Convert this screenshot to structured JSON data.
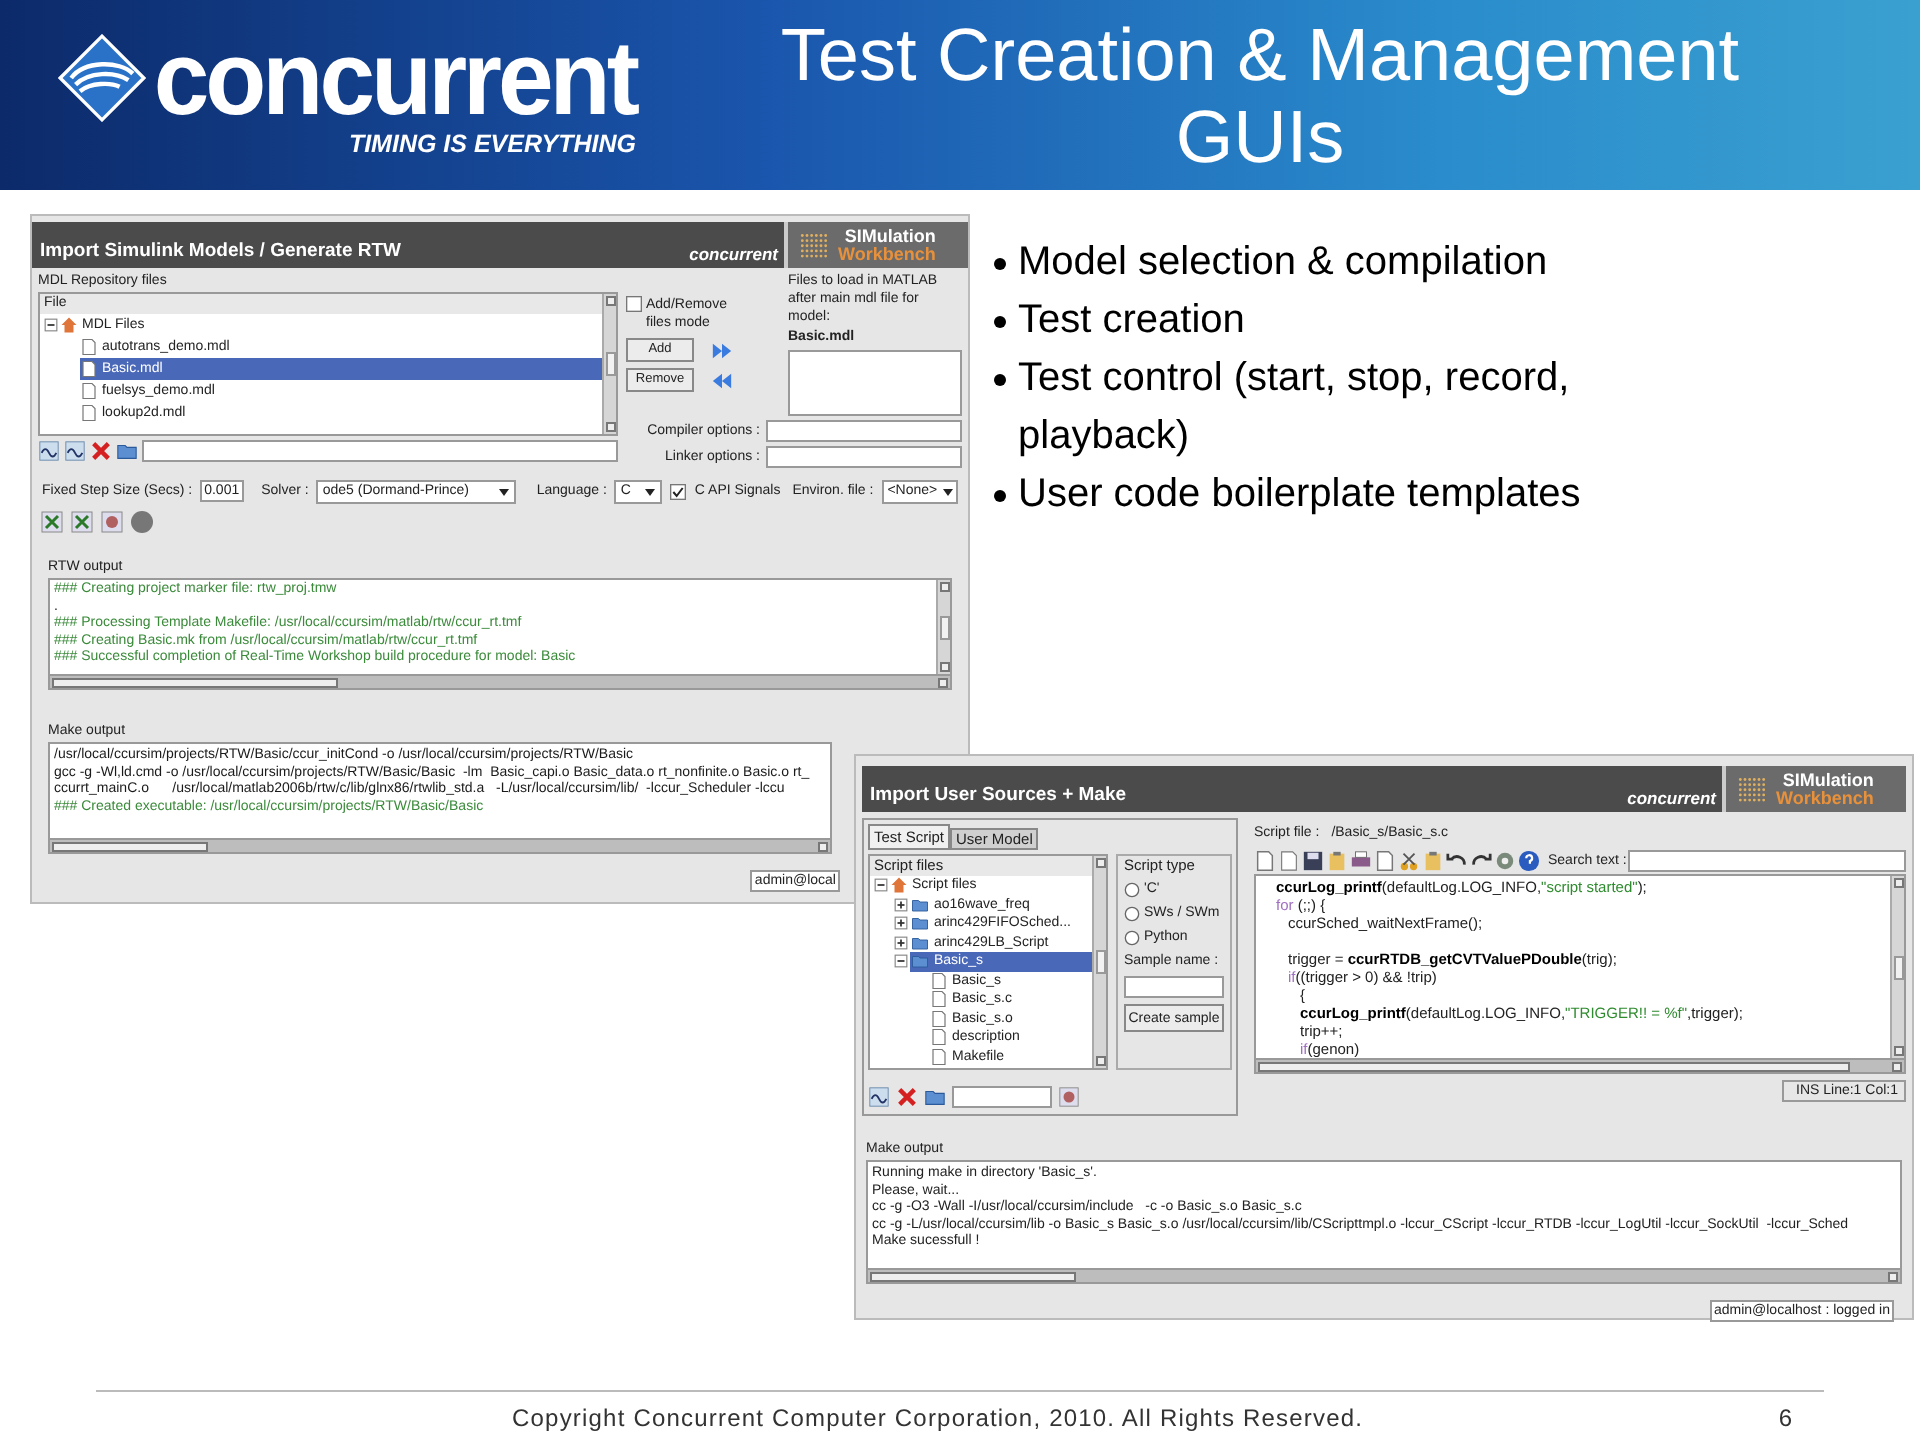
{
  "header": {
    "logo": "concurrent",
    "tagline": "TIMING IS EVERYTHING",
    "title": "Test Creation & Management GUIs"
  },
  "rtw_window": {
    "title": "Import Simulink Models / Generate RTW",
    "brand": "concurrent",
    "product_line1": "SIMulation",
    "product_line2": "Workbench",
    "repository": {
      "label": "MDL Repository files",
      "column": "File",
      "tree": [
        {
          "label": "MDL Files",
          "expanded": true,
          "selected": false,
          "children": [
            {
              "label": "autotrans_demo.mdl",
              "selected": false
            },
            {
              "label": "Basic.mdl",
              "selected": true
            },
            {
              "label": "fuelsys_demo.mdl",
              "selected": false
            },
            {
              "label": "lookup2d.mdl",
              "selected": false
            }
          ]
        }
      ]
    },
    "add_remove_mode": {
      "label": "Add/Remove files mode",
      "checked": false
    },
    "buttons": [
      "Add",
      "Remove"
    ],
    "files_to_load": {
      "label": "Files to load in MATLAB after main mdl file for model:",
      "model": "Basic.mdl"
    },
    "compiler_options": {
      "label": "Compiler options :"
    },
    "linker_options": {
      "label": "Linker options :"
    },
    "settings": {
      "step_label": "Fixed Step Size (Secs) :",
      "step_value": "0.001",
      "solver_label": "Solver :",
      "solver_value": "ode5 (Dormand-Prince)",
      "language_label": "Language :",
      "language_value": "C",
      "c_api": {
        "label": "C API Signals",
        "checked": true
      },
      "environ_label": "Environ. file :",
      "environ_value": "<None>"
    },
    "rtw_output": {
      "label": "RTW output",
      "lines": [
        {
          "text": "### Creating project marker file: rtw_proj.tmw",
          "color": "#3a8a3a"
        },
        {
          "text": "."
        },
        {
          "text": "### Processing Template Makefile: /usr/local/ccursim/matlab/rtw/ccur_rt.tmf",
          "color": "#3a8a3a"
        },
        {
          "text": "### Creating Basic.mk from /usr/local/ccursim/matlab/rtw/ccur_rt.tmf",
          "color": "#3a8a3a"
        },
        {
          "text": "### Successful completion of Real-Time Workshop build procedure for model: Basic",
          "color": "#3a8a3a"
        }
      ]
    },
    "make_output": {
      "label": "Make output",
      "lines": [
        {
          "text": "/usr/local/ccursim/projects/RTW/Basic/ccur_initCond -o /usr/local/ccursim/projects/RTW/Basic",
          "color": "#1a1a1a"
        },
        {
          "text": "gcc -g -Wl,ld.cmd -o /usr/local/ccursim/projects/RTW/Basic/Basic  -lm  Basic_capi.o Basic_data.o rt_nonfinite.o Basic.o rt_",
          "color": "#1a1a1a"
        },
        {
          "text": "ccurrt_mainC.o      /usr/local/matlab2006b/rtw/c/lib/glnx86/rtwlib_std.a   -L/usr/local/ccursim/lib/  -lccur_Scheduler -lccu",
          "color": "#1a1a1a"
        },
        {
          "text": "### Created executable: /usr/local/ccursim/projects/RTW/Basic/Basic",
          "color": "#3a8a3a"
        }
      ]
    },
    "status": "admin@local"
  },
  "bullets": [
    "Model selection & compilation",
    "Test creation",
    "Test control (start, stop, record, playback)",
    "User code boilerplate templates"
  ],
  "make_window": {
    "title": "Import User Sources + Make",
    "brand": "concurrent",
    "product_line1": "SIMulation",
    "product_line2": "Workbench",
    "tabs": [
      {
        "label": "Test Script",
        "selected": true
      },
      {
        "label": "User Model",
        "selected": false
      }
    ],
    "scripts": {
      "column": "Script files",
      "tree": [
        {
          "label": "Script files",
          "expanded": true,
          "selected": false,
          "children": [
            {
              "label": "ao16wave_freq",
              "expanded": false,
              "selected": false
            },
            {
              "label": "arinc429FIFOSched...",
              "expanded": false,
              "selected": false
            },
            {
              "label": "arinc429LB_Script",
              "expanded": false,
              "selected": false
            },
            {
              "label": "Basic_s",
              "expanded": true,
              "selected": true,
              "children": [
                {
                  "label": "Basic_s",
                  "selected": false
                },
                {
                  "label": "Basic_s.c",
                  "selected": false
                },
                {
                  "label": "Basic_s.o",
                  "selected": false
                },
                {
                  "label": "description",
                  "selected": false
                },
                {
                  "label": "Makefile",
                  "selected": false
                }
              ]
            }
          ]
        }
      ]
    },
    "script_type": {
      "label": "Script type",
      "options": [
        {
          "label": "'C'",
          "selected": false
        },
        {
          "label": "SWs / SWm",
          "selected": false
        },
        {
          "label": "Python",
          "selected": false
        }
      ]
    },
    "sample_name": {
      "label": "Sample name :"
    },
    "create_button": "Create sample",
    "script_file": {
      "label": "Script file :",
      "path": "/Basic_s/Basic_s.c"
    },
    "search": {
      "label": "Search text :"
    },
    "code": [
      {
        "kind": "code",
        "tokens": [
          {
            "text": "ccurLog_printf",
            "kind": "fn"
          },
          {
            "text": "(defaultLog.LOG_INFO,",
            "kind": "plain"
          },
          {
            "text": "\"script started\"",
            "kind": "str"
          },
          {
            "text": ");",
            "kind": "plain"
          }
        ]
      },
      {
        "kind": "code",
        "tokens": [
          {
            "text": "for",
            "kind": "kw"
          },
          {
            "text": " (;;) {",
            "kind": "plain"
          }
        ],
        "children": [
          {
            "kind": "code",
            "tokens": [
              {
                "text": "ccurSched_waitNextFrame();",
                "kind": "plain"
              }
            ]
          },
          {
            "kind": "blank"
          },
          {
            "kind": "code",
            "tokens": [
              {
                "text": "trigger = ",
                "kind": "plain"
              },
              {
                "text": "ccurRTDB_getCVTValuePDouble",
                "kind": "fn"
              },
              {
                "text": "(trig);",
                "kind": "plain"
              }
            ]
          },
          {
            "kind": "code",
            "tokens": [
              {
                "text": "if",
                "kind": "kw"
              },
              {
                "text": "((trigger > 0) && !trip)",
                "kind": "plain"
              }
            ],
            "children": [
              {
                "kind": "code",
                "tokens": [
                  {
                    "text": "{",
                    "kind": "plain"
                  }
                ]
              },
              {
                "kind": "code",
                "tokens": [
                  {
                    "text": "ccurLog_printf",
                    "kind": "fn"
                  },
                  {
                    "text": "(defaultLog.LOG_INFO,",
                    "kind": "plain"
                  },
                  {
                    "text": "\"TRIGGER!! = %f\"",
                    "kind": "str"
                  },
                  {
                    "text": ",trigger);",
                    "kind": "plain"
                  }
                ]
              },
              {
                "kind": "code",
                "tokens": [
                  {
                    "text": "trip++;",
                    "kind": "plain"
                  }
                ]
              },
              {
                "kind": "code",
                "tokens": [
                  {
                    "text": "if",
                    "kind": "kw"
                  },
                  {
                    "text": "(genon)",
                    "kind": "plain"
                  }
                ]
              }
            ]
          }
        ]
      }
    ],
    "editor_status": "INS Line:1 Col:1",
    "make_output": {
      "label": "Make output",
      "lines": [
        "Running make in directory 'Basic_s'.",
        "Please, wait...",
        "cc -g -O3 -Wall -I/usr/local/ccursim/include   -c -o Basic_s.o Basic_s.c",
        "cc -g -L/usr/local/ccursim/lib -o Basic_s Basic_s.o /usr/local/ccursim/lib/CScripttmpl.o -lccur_CScript -lccur_RTDB -lccur_LogUtil -lccur_SockUtil  -lccur_Sched",
        "Make sucessfull !"
      ]
    },
    "status": "admin@localhost : logged in"
  },
  "footer": {
    "copyright": "Copyright Concurrent Computer Corporation, 2010. All Rights Reserved.",
    "page": "6"
  }
}
